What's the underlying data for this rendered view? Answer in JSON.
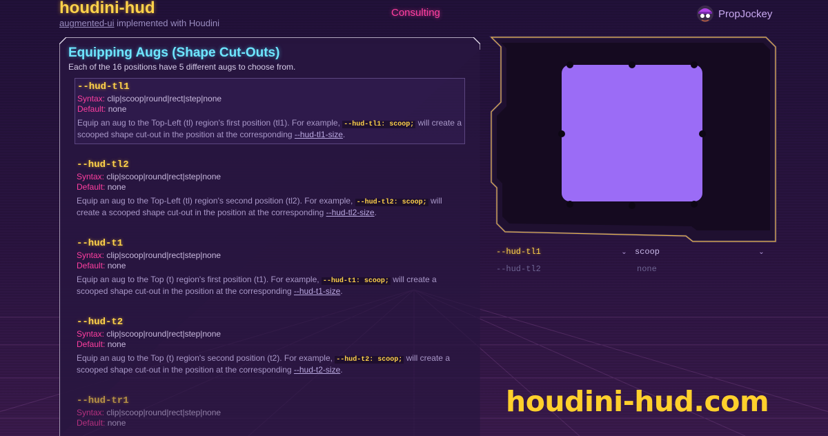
{
  "header": {
    "title": "houdini-hud",
    "subtitle_link": "augmented-ui",
    "subtitle_rest": " implemented with Houdini",
    "consulting": "Consulting",
    "propjockey": "PropJockey"
  },
  "section": {
    "title": "Equipping Augs (Shape Cut-Outs)",
    "description": "Each of the 16 positions have 5 different augs to choose from."
  },
  "labels": {
    "syntax": "Syntax:",
    "default": "Default:"
  },
  "properties": [
    {
      "name": "--hud-tl1",
      "syntax": "clip|scoop|round|rect|step|none",
      "default": "none",
      "desc_before": "Equip an aug to the Top-Left (tl) region's first position (tl1). For example, ",
      "code": "--hud-tl1: scoop;",
      "desc_middle": " will create a scooped shape cut-out in the position at the corresponding ",
      "link": "--hud-tl1-size",
      "desc_end": "."
    },
    {
      "name": "--hud-tl2",
      "syntax": "clip|scoop|round|rect|step|none",
      "default": "none",
      "desc_before": "Equip an aug to the Top-Left (tl) region's second position (tl2). For example, ",
      "code": "--hud-tl2: scoop;",
      "desc_middle": " will create a scooped shape cut-out in the position at the corresponding ",
      "link": "--hud-tl2-size",
      "desc_end": "."
    },
    {
      "name": "--hud-t1",
      "syntax": "clip|scoop|round|rect|step|none",
      "default": "none",
      "desc_before": "Equip an aug to the Top (t) region's first position (t1). For example, ",
      "code": "--hud-t1: scoop;",
      "desc_middle": " will create a scooped shape cut-out in the position at the corresponding ",
      "link": "--hud-t1-size",
      "desc_end": "."
    },
    {
      "name": "--hud-t2",
      "syntax": "clip|scoop|round|rect|step|none",
      "default": "none",
      "desc_before": "Equip an aug to the Top (t) region's second position (t2). For example, ",
      "code": "--hud-t2: scoop;",
      "desc_middle": " will create a scooped shape cut-out in the position at the corresponding ",
      "link": "--hud-t2-size",
      "desc_end": "."
    },
    {
      "name": "--hud-tr1",
      "syntax": "clip|scoop|round|rect|step|none",
      "default": "none"
    }
  ],
  "controls": [
    {
      "property": "--hud-tl1",
      "value": "scoop"
    },
    {
      "property": "--hud-tl2",
      "value": "none"
    }
  ],
  "watermark": "houdini-hud.com",
  "colors": {
    "accent_yellow": "#ffd24a",
    "accent_pink": "#ff3fa0",
    "accent_cyan": "#6ee6ff",
    "demo_fill": "#9b6cf6"
  },
  "icons": {
    "chevron": "chevron-down-icon",
    "avatar": "propjockey-logo-icon"
  }
}
